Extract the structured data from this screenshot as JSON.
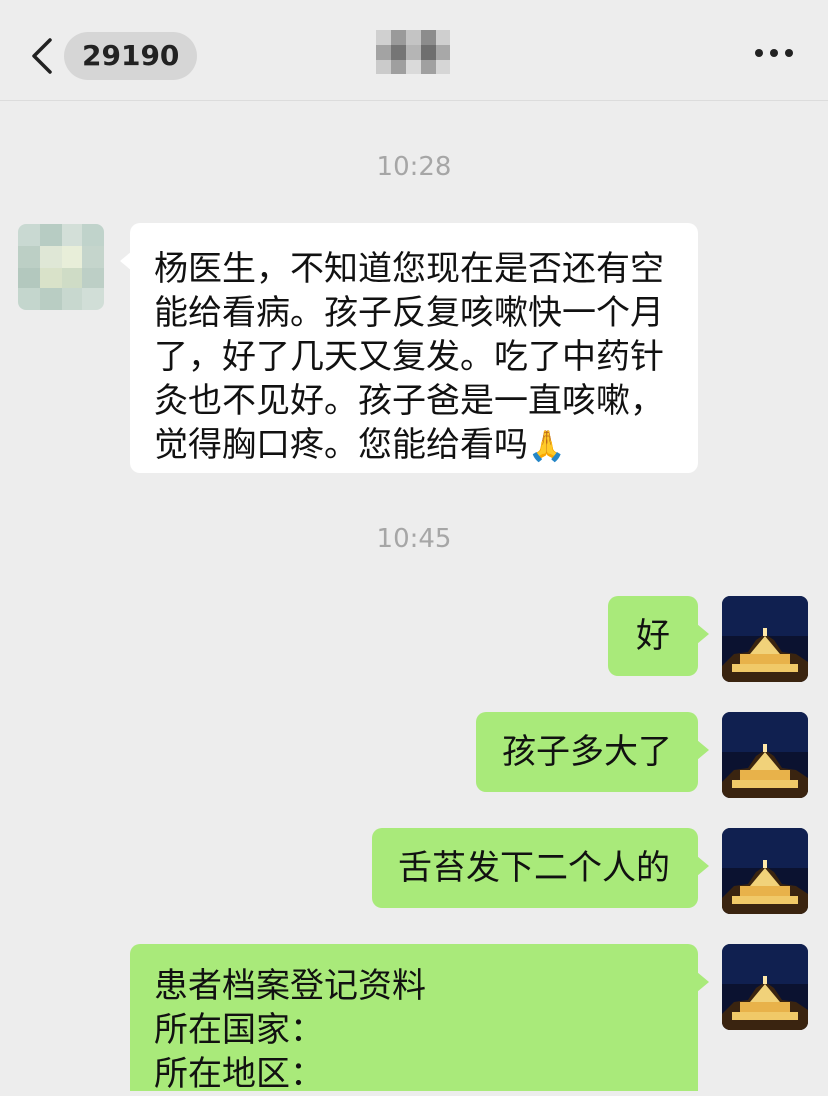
{
  "header": {
    "back_label": "",
    "unread_count": "29190",
    "more_label": ""
  },
  "colors": {
    "background": "#ededed",
    "incoming_bubble": "#ffffff",
    "outgoing_bubble": "#a9ea7a",
    "timestamp": "#a6a6a6"
  },
  "messages": {
    "time_1": "10:28",
    "incoming_1": {
      "lines": [
        "杨医生，不知道您现在是否还有空",
        "能给看病。孩子反复咳嗽快一个月",
        "了，好了几天又复发。吃了中药针",
        "灸也不见好。孩子爸是一直咳嗽，",
        "觉得胸口疼。您能给看吗"
      ],
      "emoji": "🙏"
    },
    "time_2": "10:45",
    "outgoing_1": "好",
    "outgoing_2": "孩子多大了",
    "outgoing_3": "舌苔发下二个人的",
    "outgoing_4": {
      "lines": [
        "患者档案登记资料",
        "所在国家：",
        "所在地区："
      ]
    }
  },
  "icons": [
    "chevron-left-icon",
    "more-dots-icon",
    "pixelated-avatar",
    "night-temple-avatar"
  ]
}
